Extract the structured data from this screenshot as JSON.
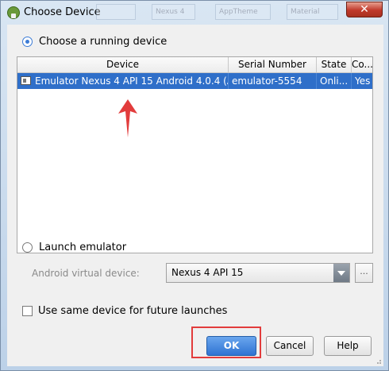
{
  "window": {
    "title": "Choose Device",
    "close_glyph": "✕",
    "background_tabs": [
      "",
      "Nexus 4",
      "AppTheme",
      "Material"
    ]
  },
  "running": {
    "label": "Choose a running device",
    "selected": true,
    "columns": [
      "Device",
      "Serial Number",
      "State",
      "Co..."
    ],
    "rows": [
      {
        "device": "Emulator Nexus 4 API 15 Android 4.0.4 (A",
        "serial": "emulator-5554",
        "state": "Onli...",
        "compatible": "Yes",
        "selected": true
      }
    ]
  },
  "emulator": {
    "label": "Launch emulator",
    "selected": false,
    "avd_label": "Android virtual device:",
    "avd_value": "Nexus 4 API 15",
    "more_label": "..."
  },
  "same_device": {
    "label": "Use same device for future launches",
    "checked": false
  },
  "buttons": {
    "ok": "OK",
    "cancel": "Cancel",
    "help": "Help"
  },
  "colors": {
    "selection": "#2f6fc9",
    "annotation": "#e23c3c",
    "primary_button": "#3b7bd6"
  },
  "icons": {
    "app": "android-studio-icon",
    "device": "emulator-device-icon",
    "arrow": "red-annotation-arrow"
  }
}
